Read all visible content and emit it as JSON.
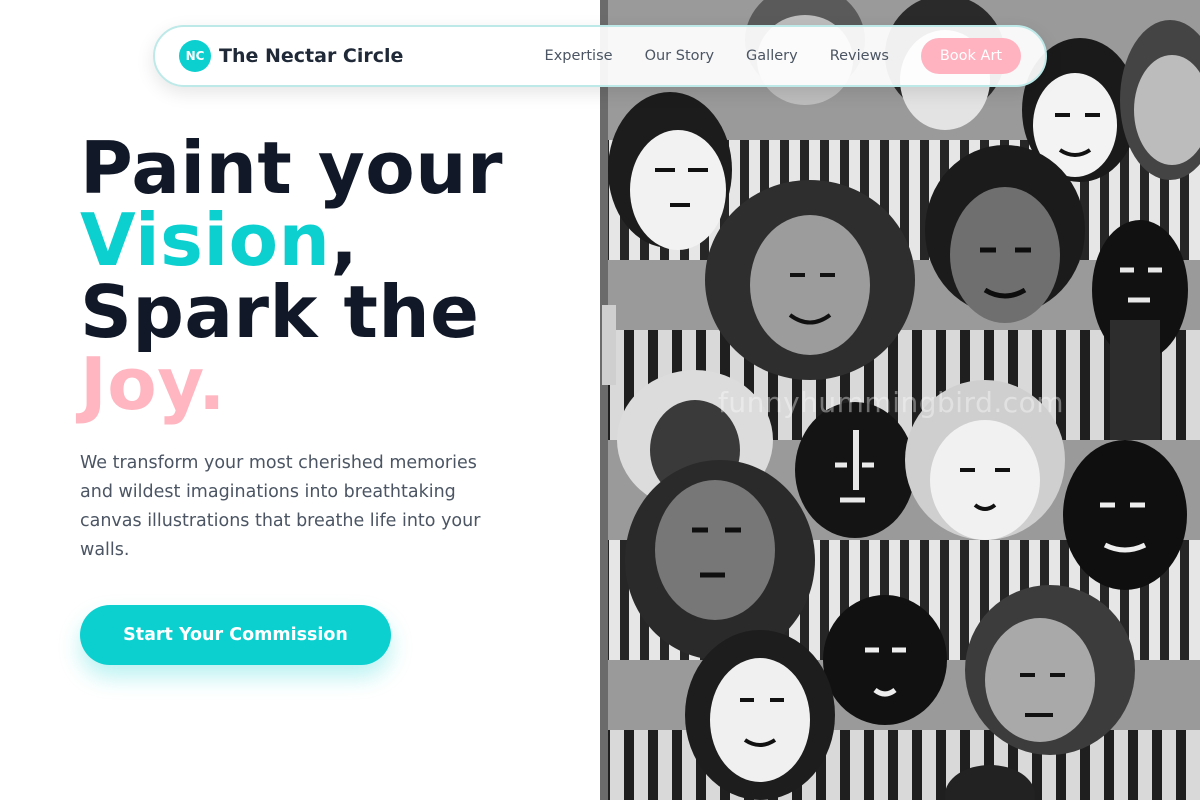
{
  "nav": {
    "logo_initials": "NC",
    "brand": "The Nectar Circle",
    "links": [
      "Expertise",
      "Our Story",
      "Gallery",
      "Reviews"
    ],
    "cta_label": "Book Art"
  },
  "hero": {
    "headline_line1": "Paint your",
    "headline_word_teal": "Vision",
    "headline_comma": ",",
    "headline_line3": "Spark the",
    "headline_word_pink": "Joy.",
    "subtitle": "We transform your most cherished memories and wildest imaginations into breathtaking canvas illustrations that breathe life into your walls.",
    "cta_label": "Start Your Commission"
  },
  "image": {
    "watermark": "funnyhummingbird.com",
    "description_icon": "mural-of-cartoon-faces-image"
  },
  "colors": {
    "accent_teal": "#0ccfd0",
    "accent_pink": "#ffb6c1",
    "text_dark": "#111827",
    "text_muted": "#4b5563"
  }
}
